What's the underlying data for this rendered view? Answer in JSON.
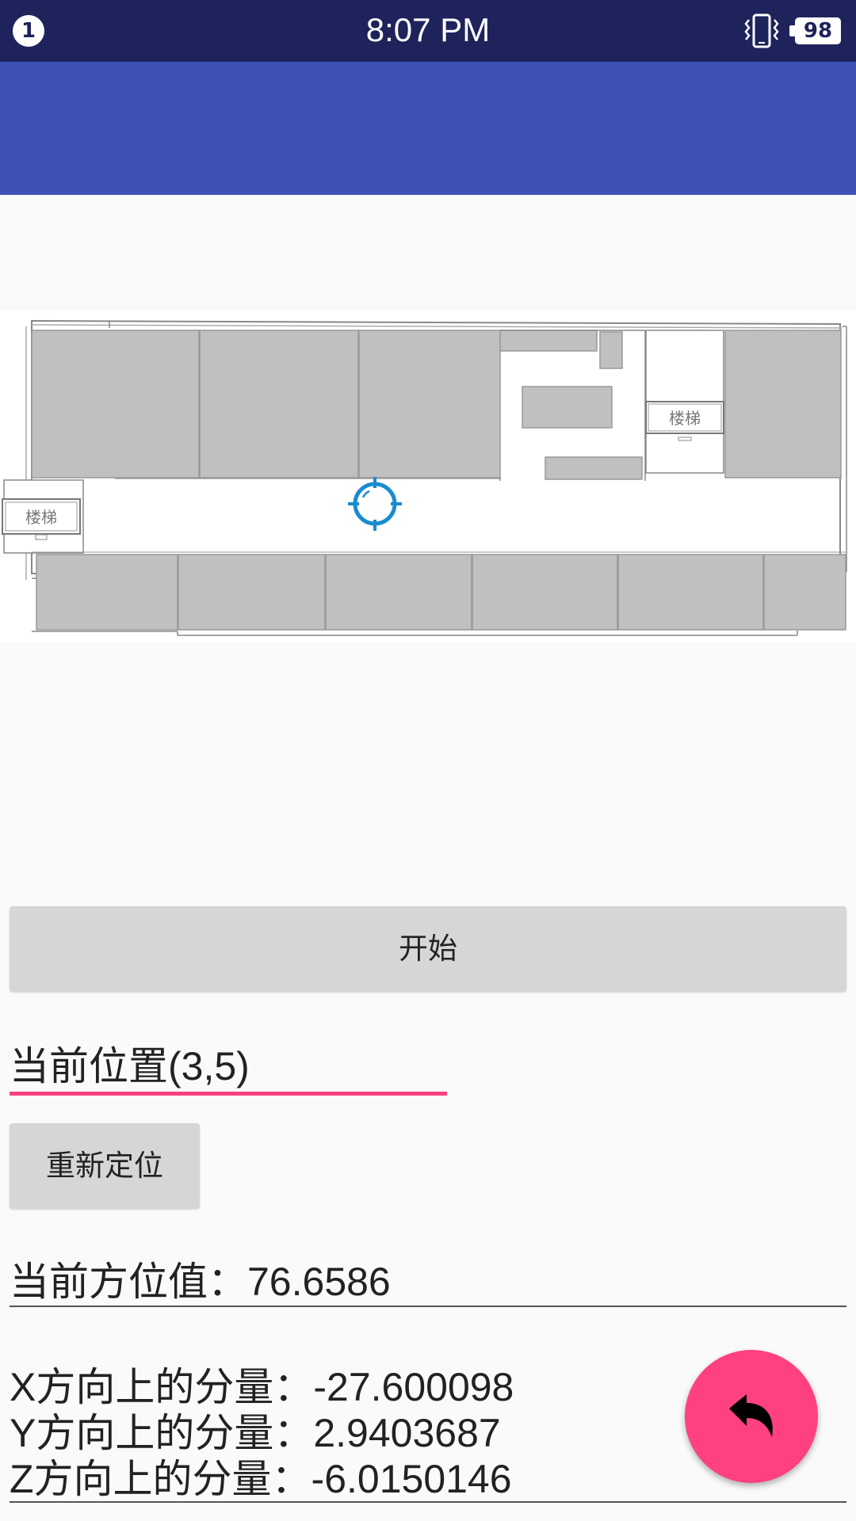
{
  "status_bar": {
    "notification_count": "1",
    "time": "8:07 PM",
    "vibrate_icon": "vibrate-icon",
    "battery_level": "98"
  },
  "map": {
    "stairs_label_top_right": "楼梯",
    "stairs_label_left": "楼梯",
    "locator_icon": "gps-crosshair-icon"
  },
  "start_button": {
    "label": "开始"
  },
  "current_position": {
    "text": "当前位置(3,5)"
  },
  "relocate_button": {
    "label": "重新定位"
  },
  "azimuth": {
    "label": "当前方位值：",
    "value": "76.6586"
  },
  "components": [
    {
      "label": "X方向上的分量：",
      "value": "-27.600098"
    },
    {
      "label": "Y方向上的分量：",
      "value": "2.9403687"
    },
    {
      "label": "Z方向上的分量：",
      "value": "-6.0150146"
    }
  ],
  "fab": {
    "icon": "reply-arrow-icon"
  },
  "colors": {
    "status_bar": "#1f235c",
    "app_bar": "#3f51b5",
    "accent": "#ff4081",
    "room_fill": "#c0c0c0",
    "locator": "#1a8bd0"
  }
}
